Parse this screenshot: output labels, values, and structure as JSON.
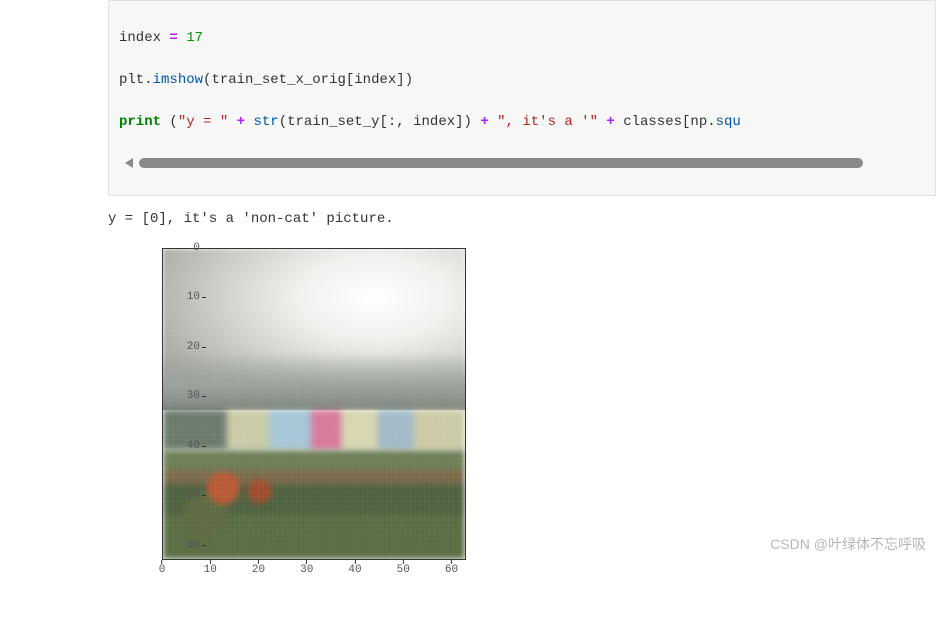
{
  "code": {
    "line1": {
      "var": "index",
      "op": "=",
      "val": "17"
    },
    "line2": {
      "mod": "plt",
      "dot": ".",
      "fn": "imshow",
      "open": "(",
      "arg": "train_set_x_orig[index]",
      "close": ")"
    },
    "line3": {
      "kw": "print",
      "sp": " ",
      "open": "(",
      "s1": "\"y = \"",
      "plus1": " + ",
      "fn1": "str",
      "p1o": "(",
      "arg1": "train_set_y[:, index]",
      "p1c": ")",
      "plus2": " + ",
      "s2": "\", it's a '\"",
      "plus3": " + ",
      "arg2": "classes[np",
      "dot": ".",
      "fn2": "squ"
    }
  },
  "output": {
    "stdout": "y = [0], it's a 'non-cat' picture."
  },
  "chart_data": {
    "type": "heatmap",
    "title": "",
    "xlabel": "",
    "ylabel": "",
    "xlim": [
      0,
      63
    ],
    "ylim": [
      63,
      0
    ],
    "xticks": [
      0,
      10,
      20,
      30,
      40,
      50,
      60
    ],
    "yticks": [
      0,
      10,
      20,
      30,
      40,
      50,
      60
    ],
    "image_description": "64x64 RGB pixelated photo of a cloudy sky over a town with colorful buildings and green foreground (non-cat class)"
  },
  "watermark": "CSDN @叶绿体不忘呼吸"
}
